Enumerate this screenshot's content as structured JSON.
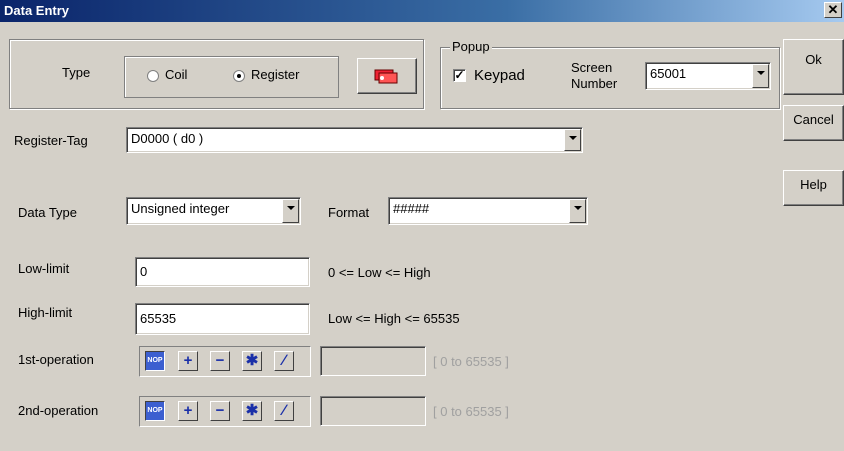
{
  "window": {
    "title": "Data Entry",
    "close_glyph": "✕"
  },
  "type_group": {
    "label": "Type",
    "coil": "Coil",
    "register": "Register",
    "selected": "Register"
  },
  "popup": {
    "legend": "Popup",
    "keypad_label": "Keypad",
    "keypad_checked": true,
    "screen_label_1": "Screen",
    "screen_label_2": "Number",
    "screen_value": "65001"
  },
  "buttons": {
    "ok": "Ok",
    "cancel": "Cancel",
    "help": "Help"
  },
  "register_tag": {
    "label": "Register-Tag",
    "value": "D0000 ( d0 )"
  },
  "data_type": {
    "label": "Data Type",
    "value": "Unsigned integer"
  },
  "format": {
    "label": "Format",
    "value": "#####"
  },
  "low_limit": {
    "label": "Low-limit",
    "value": "0",
    "hint": "0 <= Low <= High"
  },
  "high_limit": {
    "label": "High-limit",
    "value": "65535",
    "hint": "Low <= High <= 65535"
  },
  "op1": {
    "label": "1st-operation",
    "range": "[ 0 to 65535 ]"
  },
  "op2": {
    "label": "2nd-operation",
    "range": "[ 0 to 65535 ]"
  },
  "op_icons": {
    "nop": "NOP",
    "plus": "+",
    "minus": "−",
    "multiply": "✱",
    "divide": "∕"
  }
}
